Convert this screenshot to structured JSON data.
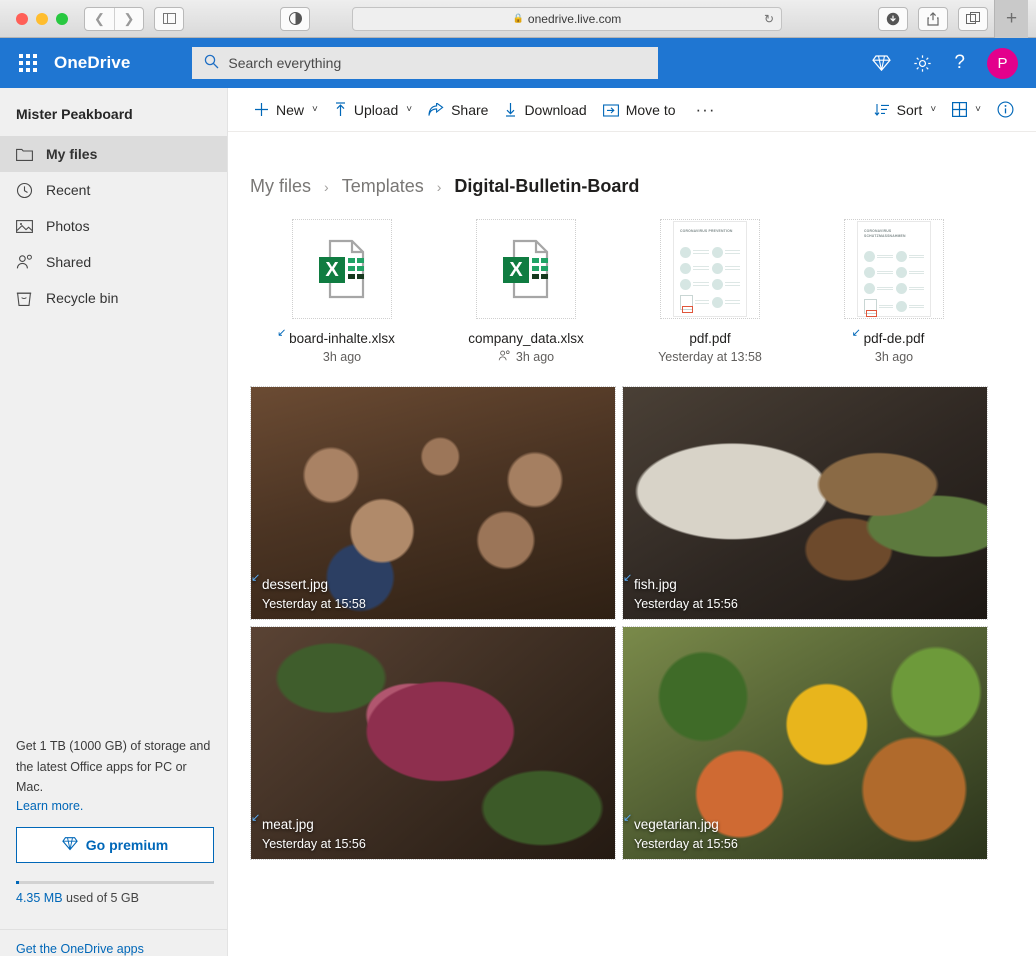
{
  "browser": {
    "url": "onedrive.live.com",
    "lock_icon": "lock-icon",
    "reload_icon": "reload-icon",
    "back_icon": "back-chevron-icon",
    "forward_icon": "forward-chevron-icon",
    "sidebar_icon": "sidebar-toggle-icon",
    "appearance_icon": "reader-contrast-icon",
    "downloads_icon": "downloads-icon",
    "share_icon": "share-icon",
    "tabs_icon": "tab-overview-icon",
    "newtab_label": "+"
  },
  "suite": {
    "brand": "OneDrive",
    "waffle_icon": "app-launcher-icon",
    "search_placeholder": "Search everything",
    "search_icon": "search-icon",
    "diamond_icon": "premium-diamond-icon",
    "gear_icon": "settings-gear-icon",
    "help_icon": "help-question-icon",
    "avatar_initial": "P",
    "accent": "#1f76d2",
    "avatar_color": "#e3008c"
  },
  "sidebar": {
    "account_name": "Mister Peakboard",
    "items": [
      {
        "label": "My files",
        "icon": "folder-icon",
        "active": true
      },
      {
        "label": "Recent",
        "icon": "clock-icon",
        "active": false
      },
      {
        "label": "Photos",
        "icon": "photo-icon",
        "active": false
      },
      {
        "label": "Shared",
        "icon": "people-icon",
        "active": false
      },
      {
        "label": "Recycle bin",
        "icon": "recycle-bin-icon",
        "active": false
      }
    ],
    "promo_line1": "Get 1 TB (1000 GB) of storage and",
    "promo_line2": "the latest Office apps for PC or Mac.",
    "learn_more": "Learn more.",
    "go_premium": "Go premium",
    "premium_icon": "premium-diamond-icon",
    "storage_used": "4.35 MB",
    "storage_rest": " used of 5 GB",
    "apps_link": "Get the OneDrive apps"
  },
  "toolbar": {
    "new": "New",
    "upload": "Upload",
    "share": "Share",
    "download": "Download",
    "move_to": "Move to",
    "more": "···",
    "sort": "Sort",
    "view_icon": "grid-view-icon",
    "info_icon": "info-icon",
    "chevron": "˅"
  },
  "breadcrumb": {
    "items": [
      "My files",
      "Templates",
      "Digital-Bulletin-Board"
    ],
    "separator": "›"
  },
  "files": [
    {
      "name": "board-inhalte.xlsx",
      "meta": "3h ago",
      "type": "xlsx",
      "synced": true,
      "shared": false
    },
    {
      "name": "company_data.xlsx",
      "meta": "3h ago",
      "type": "xlsx",
      "synced": false,
      "shared": true
    },
    {
      "name": "pdf.pdf",
      "meta": "Yesterday at 13:58",
      "type": "pdf",
      "synced": false,
      "shared": false,
      "thumb_title": "CORONAVIRUS\nPREVENTION"
    },
    {
      "name": "pdf-de.pdf",
      "meta": "3h ago",
      "type": "pdf",
      "synced": true,
      "shared": false,
      "thumb_title": "CORONAVIRUS\nSCHUTZMASSNAHMEN"
    }
  ],
  "images": [
    {
      "name": "dessert.jpg",
      "meta": "Yesterday at 15:58",
      "photo": "ph-dessert",
      "synced": true
    },
    {
      "name": "fish.jpg",
      "meta": "Yesterday at 15:56",
      "photo": "ph-fish",
      "synced": true
    },
    {
      "name": "meat.jpg",
      "meta": "Yesterday at 15:56",
      "photo": "ph-meat",
      "synced": true
    },
    {
      "name": "vegetarian.jpg",
      "meta": "Yesterday at 15:56",
      "photo": "ph-veg",
      "synced": true
    }
  ]
}
